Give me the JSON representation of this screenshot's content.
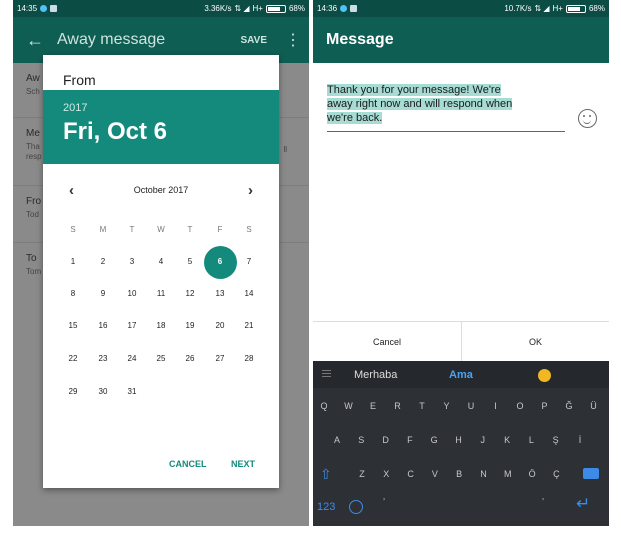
{
  "left": {
    "status": {
      "time": "14:35",
      "speed": "3.36K/s",
      "network": "H+",
      "battery": "68%"
    },
    "appbar": {
      "back_icon": "arrow-left-icon",
      "title": "Away message",
      "save": "SAVE",
      "more_icon": "kebab-icon"
    },
    "background_items": [
      {
        "title": "Aw",
        "subtitle": "Sch"
      },
      {
        "title": "Me",
        "subtitle": "Tha\nresp",
        "trail": "ll"
      },
      {
        "title": "Fro",
        "subtitle": "Tod"
      },
      {
        "title": "To",
        "subtitle": "Tom"
      }
    ],
    "dialog": {
      "title": "From",
      "year": "2017",
      "date": "Fri, Oct 6",
      "month": "October 2017",
      "prev_icon": "chevron-left-icon",
      "next_icon": "chevron-right-icon",
      "weekdays": [
        "S",
        "M",
        "T",
        "W",
        "T",
        "F",
        "S"
      ],
      "weeks": [
        [
          "",
          "",
          "",
          "",
          "",
          "",
          ""
        ],
        [
          "1",
          "2",
          "3",
          "4",
          "5",
          "6",
          "7"
        ],
        [
          "8",
          "9",
          "10",
          "11",
          "12",
          "13",
          "14"
        ],
        [
          "15",
          "16",
          "17",
          "18",
          "19",
          "20",
          "21"
        ],
        [
          "22",
          "23",
          "24",
          "25",
          "26",
          "27",
          "28"
        ],
        [
          "29",
          "30",
          "31",
          "",
          "",
          "",
          ""
        ]
      ],
      "selected_day": "6",
      "cancel": "CANCEL",
      "next": "NEXT",
      "accent": "#138a7b"
    }
  },
  "right": {
    "status": {
      "time": "14:36",
      "speed": "10.7K/s",
      "network": "H+",
      "battery": "68%"
    },
    "appbar": {
      "title": "Message"
    },
    "message": {
      "lines": [
        "Thank you for your message! We're",
        "away right now and will respond when",
        "we're back."
      ],
      "emoji_icon": "smiley-icon"
    },
    "actions": {
      "cancel": "Cancel",
      "ok": "OK"
    },
    "keyboard": {
      "suggestions": [
        "Merhaba",
        "Ama"
      ],
      "menu_icon": "menu-icon",
      "suggestion_emoji_icon": "emoji-icon",
      "row1": [
        "Q",
        "W",
        "E",
        "R",
        "T",
        "Y",
        "U",
        "I",
        "O",
        "P",
        "Ğ",
        "Ü"
      ],
      "row2": [
        "A",
        "S",
        "D",
        "F",
        "G",
        "H",
        "J",
        "K",
        "L",
        "Ş",
        "İ"
      ],
      "row3": [
        "Z",
        "X",
        "C",
        "V",
        "B",
        "N",
        "M",
        "Ö",
        "Ç"
      ],
      "shift_icon": "shift-icon",
      "delete_icon": "backspace-icon",
      "numbers": "123",
      "emoji_key_icon": "emoji-key-icon",
      "enter_icon": "enter-icon",
      "space_dots": [
        "‚",
        "‚"
      ]
    }
  }
}
